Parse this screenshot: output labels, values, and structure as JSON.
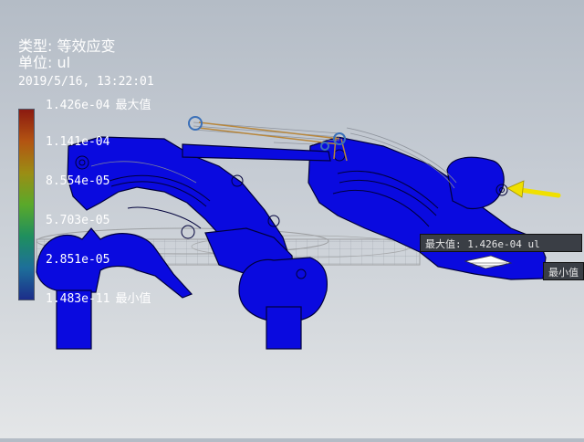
{
  "header": {
    "type_line": "类型: 等效应变",
    "unit_line": "单位: ul",
    "timestamp": "2019/5/16, 13:22:01"
  },
  "legend": {
    "gradient_colors": [
      "#8b1a10",
      "#b35412",
      "#9b8d14",
      "#5aa92a",
      "#1f8f5e",
      "#1d6f9a",
      "#1c2d8a"
    ],
    "ticks": [
      {
        "value": "1.426e-04",
        "note": "最大值"
      },
      {
        "value": "1.141e-04",
        "note": ""
      },
      {
        "value": "8.554e-05",
        "note": ""
      },
      {
        "value": "5.703e-05",
        "note": ""
      },
      {
        "value": "2.851e-05",
        "note": ""
      },
      {
        "value": "1.483e-11",
        "note": "最小值"
      }
    ]
  },
  "probes": {
    "max_label": "最大值: 1.426e-04 ul",
    "min_label": "最小值"
  },
  "colors": {
    "part_fill": "#0a0adf",
    "part_edge": "#00003a",
    "arrow": "#f0e000"
  }
}
